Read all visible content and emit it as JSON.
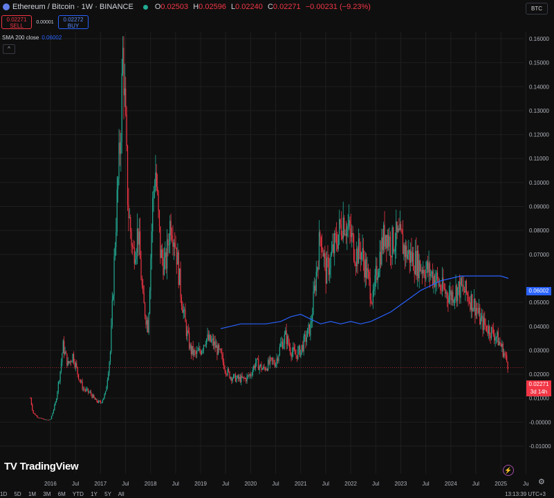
{
  "header": {
    "symbol": "Ethereum / Bitcoin · 1W · BINANCE",
    "ohlc": [
      {
        "k": "O",
        "v": "0.02503"
      },
      {
        "k": "H",
        "v": "0.02596"
      },
      {
        "k": "L",
        "v": "0.02240"
      },
      {
        "k": "C",
        "v": "0.02271"
      },
      {
        "k": "",
        "v": "−0.00231 (−9.23%)"
      }
    ],
    "currency": "BTC"
  },
  "trade": {
    "sell_price": "0.02271",
    "sell_label": "SELL",
    "spread": "0.00001",
    "buy_price": "0.02272",
    "buy_label": "BUY"
  },
  "indicator": {
    "name": "SMA 200 close",
    "value": "0.06002"
  },
  "price_tags": {
    "sma": "0.06002",
    "last": "0.02271",
    "countdown": "3d 14h"
  },
  "colors": {
    "up": "#22ab94",
    "down": "#f23645",
    "sma": "#2962ff",
    "grid": "#1f1f1f"
  },
  "logo": "TradingView",
  "bottom": {
    "ranges": [
      "1D",
      "5D",
      "1M",
      "3M",
      "6M",
      "YTD",
      "1Y",
      "5Y",
      "All"
    ],
    "time": "13:13:39 UTC+3"
  },
  "chart_data": {
    "type": "candlestick",
    "y_ticks": [
      "0.16000",
      "0.15000",
      "0.14000",
      "0.13000",
      "0.12000",
      "0.11000",
      "0.10000",
      "0.09000",
      "0.08000",
      "0.07000",
      "0.05000",
      "0.04000",
      "0.03000",
      "0.02000",
      "0.01000",
      "-0.00000",
      "-0.01000"
    ],
    "x_ticks": [
      "2016",
      "Jul",
      "2017",
      "Jul",
      "2018",
      "Jul",
      "2019",
      "Jul",
      "2020",
      "Jul",
      "2021",
      "Jul",
      "2022",
      "Jul",
      "2023",
      "Jul",
      "2024",
      "Jul",
      "2025",
      "Ju"
    ],
    "ylim": [
      -0.01,
      0.16
    ],
    "price_path": [
      [
        2015.6,
        0.01
      ],
      [
        2015.65,
        0.004
      ],
      [
        2015.75,
        0.002
      ],
      [
        2015.9,
        0.001
      ],
      [
        2016.0,
        0.001
      ],
      [
        2016.1,
        0.008
      ],
      [
        2016.2,
        0.022
      ],
      [
        2016.25,
        0.032
      ],
      [
        2016.35,
        0.024
      ],
      [
        2016.45,
        0.028
      ],
      [
        2016.55,
        0.02
      ],
      [
        2016.65,
        0.014
      ],
      [
        2016.8,
        0.012
      ],
      [
        2016.9,
        0.009
      ],
      [
        2017.0,
        0.008
      ],
      [
        2017.1,
        0.012
      ],
      [
        2017.2,
        0.03
      ],
      [
        2017.3,
        0.08
      ],
      [
        2017.4,
        0.12
      ],
      [
        2017.45,
        0.156
      ],
      [
        2017.55,
        0.09
      ],
      [
        2017.65,
        0.07
      ],
      [
        2017.75,
        0.08
      ],
      [
        2017.85,
        0.05
      ],
      [
        2017.95,
        0.04
      ],
      [
        2018.05,
        0.095
      ],
      [
        2018.1,
        0.105
      ],
      [
        2018.2,
        0.07
      ],
      [
        2018.3,
        0.065
      ],
      [
        2018.4,
        0.085
      ],
      [
        2018.5,
        0.075
      ],
      [
        2018.6,
        0.055
      ],
      [
        2018.7,
        0.04
      ],
      [
        2018.8,
        0.03
      ],
      [
        2018.9,
        0.028
      ],
      [
        2019.0,
        0.03
      ],
      [
        2019.1,
        0.035
      ],
      [
        2019.25,
        0.033
      ],
      [
        2019.4,
        0.028
      ],
      [
        2019.5,
        0.022
      ],
      [
        2019.6,
        0.019
      ],
      [
        2019.75,
        0.018
      ],
      [
        2019.9,
        0.018
      ],
      [
        2020.0,
        0.02
      ],
      [
        2020.1,
        0.025
      ],
      [
        2020.25,
        0.022
      ],
      [
        2020.4,
        0.025
      ],
      [
        2020.5,
        0.025
      ],
      [
        2020.6,
        0.032
      ],
      [
        2020.7,
        0.036
      ],
      [
        2020.8,
        0.03
      ],
      [
        2020.9,
        0.028
      ],
      [
        2021.0,
        0.03
      ],
      [
        2021.1,
        0.035
      ],
      [
        2021.2,
        0.04
      ],
      [
        2021.3,
        0.06
      ],
      [
        2021.4,
        0.08
      ],
      [
        2021.5,
        0.062
      ],
      [
        2021.6,
        0.068
      ],
      [
        2021.7,
        0.075
      ],
      [
        2021.85,
        0.085
      ],
      [
        2022.0,
        0.078
      ],
      [
        2022.1,
        0.07
      ],
      [
        2022.2,
        0.072
      ],
      [
        2022.3,
        0.064
      ],
      [
        2022.4,
        0.055
      ],
      [
        2022.45,
        0.05
      ],
      [
        2022.5,
        0.06
      ],
      [
        2022.6,
        0.072
      ],
      [
        2022.7,
        0.08
      ],
      [
        2022.8,
        0.074
      ],
      [
        2022.9,
        0.077
      ],
      [
        2023.0,
        0.076
      ],
      [
        2023.1,
        0.071
      ],
      [
        2023.2,
        0.069
      ],
      [
        2023.3,
        0.067
      ],
      [
        2023.4,
        0.065
      ],
      [
        2023.5,
        0.064
      ],
      [
        2023.6,
        0.062
      ],
      [
        2023.7,
        0.06
      ],
      [
        2023.8,
        0.056
      ],
      [
        2023.9,
        0.054
      ],
      [
        2024.0,
        0.053
      ],
      [
        2024.1,
        0.055
      ],
      [
        2024.2,
        0.056
      ],
      [
        2024.3,
        0.054
      ],
      [
        2024.4,
        0.051
      ],
      [
        2024.5,
        0.048
      ],
      [
        2024.6,
        0.042
      ],
      [
        2024.7,
        0.04
      ],
      [
        2024.8,
        0.038
      ],
      [
        2024.9,
        0.036
      ],
      [
        2025.0,
        0.032
      ],
      [
        2025.08,
        0.028
      ],
      [
        2025.15,
        0.023
      ]
    ],
    "sma_path": [
      [
        2019.4,
        0.039
      ],
      [
        2019.6,
        0.04
      ],
      [
        2019.8,
        0.041
      ],
      [
        2020.0,
        0.041
      ],
      [
        2020.3,
        0.041
      ],
      [
        2020.6,
        0.042
      ],
      [
        2020.8,
        0.044
      ],
      [
        2021.0,
        0.045
      ],
      [
        2021.2,
        0.043
      ],
      [
        2021.4,
        0.041
      ],
      [
        2021.6,
        0.042
      ],
      [
        2021.8,
        0.041
      ],
      [
        2022.0,
        0.042
      ],
      [
        2022.2,
        0.041
      ],
      [
        2022.4,
        0.042
      ],
      [
        2022.6,
        0.044
      ],
      [
        2022.8,
        0.046
      ],
      [
        2023.0,
        0.049
      ],
      [
        2023.2,
        0.052
      ],
      [
        2023.4,
        0.055
      ],
      [
        2023.6,
        0.057
      ],
      [
        2023.8,
        0.059
      ],
      [
        2024.0,
        0.06
      ],
      [
        2024.2,
        0.061
      ],
      [
        2024.5,
        0.061
      ],
      [
        2024.8,
        0.061
      ],
      [
        2025.0,
        0.061
      ],
      [
        2025.15,
        0.06
      ]
    ],
    "last_price": 0.02271,
    "sma_value": 0.06002
  }
}
